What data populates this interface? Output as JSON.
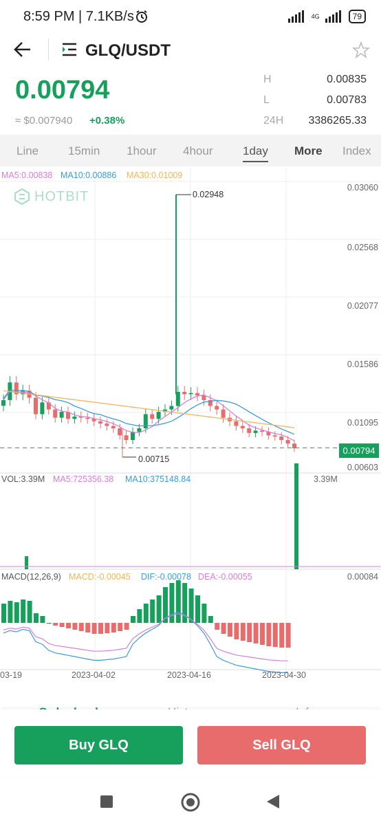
{
  "status_bar": {
    "time": "8:59 PM | 7.1KB/s",
    "network": "4G",
    "battery": "79"
  },
  "header": {
    "pair": "GLQ/USDT",
    "back_icon": "back-arrow-icon",
    "menu_icon": "list-icon",
    "favorite_icon": "star-icon"
  },
  "ticker": {
    "last_price": "0.00794",
    "usd_price": "≈ $0.007940",
    "change": "+0.38%",
    "high_label": "H",
    "high": "0.00835",
    "low_label": "L",
    "low": "0.00783",
    "vol_label": "24H",
    "vol": "3386265.33"
  },
  "tabs": [
    {
      "label": "Line"
    },
    {
      "label": "15min"
    },
    {
      "label": "1hour"
    },
    {
      "label": "4hour"
    },
    {
      "label": "1day"
    },
    {
      "label": "More"
    },
    {
      "label": "Index"
    }
  ],
  "chart": {
    "ma_legend": {
      "ma5": "MA5:0.00838",
      "ma10": "MA10:0.00886",
      "ma30": "MA30:0.01009"
    },
    "watermark": "HOTBIT",
    "y_ticks": [
      "0.03060",
      "0.02568",
      "0.02077",
      "0.01586",
      "0.01095",
      "0.00603"
    ],
    "max_label": "0.02948",
    "min_label": "0.00715",
    "current_price_tag": "0.00794",
    "vol_legend": {
      "vol": "VOL:3.39M",
      "ma5": "MA5:725356.38",
      "ma10": "MA10:375148.84"
    },
    "vol_max": "3.39M",
    "macd_legend": {
      "name": "MACD(12,26,9)",
      "macd": "MACD:-0.00045",
      "dif": "DIF:-0.00078",
      "dea": "DEA:-0.00055"
    },
    "macd_max": "0.00084",
    "x_ticks": [
      "03-19",
      "2023-04-02",
      "2023-04-16",
      "2023-04-30"
    ],
    "colors": {
      "up": "#16a05c",
      "down": "#e86c6c",
      "ma5": "#d67fd6",
      "ma10": "#3a9bd5",
      "ma30": "#f0b55c",
      "price_line": "#16a05c"
    }
  },
  "chart_data": {
    "type": "candlestick",
    "last_close": 0.00794,
    "high_marker": 0.02948,
    "low_marker": 0.00715,
    "ylim": [
      0.00603,
      0.0306
    ]
  },
  "bottom_tabs": [
    "Order book",
    "History",
    "Info"
  ],
  "actions": {
    "buy": "Buy GLQ",
    "sell": "Sell GLQ"
  },
  "nav": {
    "recent_icon": "square-icon",
    "home_icon": "home-circle-icon",
    "back_icon": "back-triangle-icon"
  }
}
